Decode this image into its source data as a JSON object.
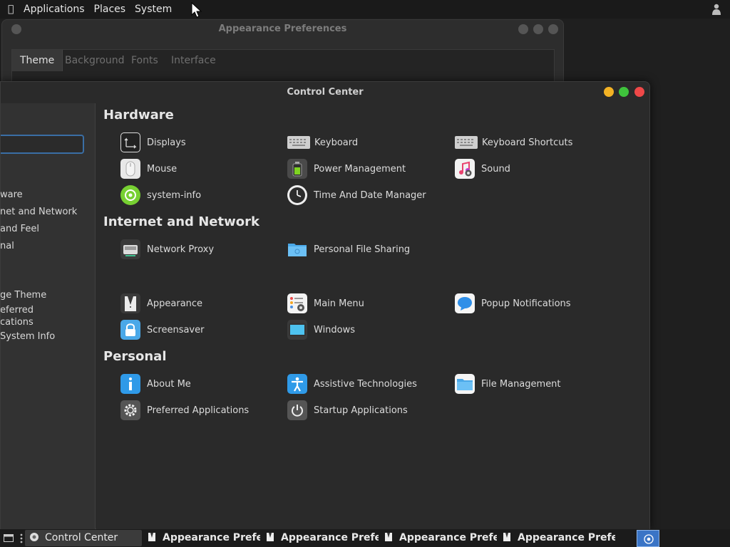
{
  "top_panel": {
    "menus": [
      "Applications",
      "Places",
      "System"
    ],
    "icons": {
      "logo": "apple-icon",
      "tray": "user-icon"
    }
  },
  "background_window": {
    "title": "Appearance Preferences",
    "tabs": [
      "Theme",
      "Background",
      "Fonts",
      "Interface"
    ],
    "active_tab": "Theme"
  },
  "control_center": {
    "title": "Control Center",
    "sidebar": {
      "categories": [
        "ware",
        "net and Network",
        "and Feel",
        "nal"
      ],
      "common_tasks": [
        "ge Theme",
        "eferred",
        "cations",
        "System Info"
      ]
    },
    "sections": [
      {
        "title": "Hardware",
        "items": [
          {
            "label": "Displays",
            "icon": "display-icon"
          },
          {
            "label": "Keyboard",
            "icon": "keyboard-icon"
          },
          {
            "label": "Keyboard Shortcuts",
            "icon": "keyboard-icon"
          },
          {
            "label": "Mouse",
            "icon": "mouse-icon"
          },
          {
            "label": "Power Management",
            "icon": "battery-icon"
          },
          {
            "label": "Sound",
            "icon": "music-note-icon"
          },
          {
            "label": "system-info",
            "icon": "system-info-icon"
          },
          {
            "label": "Time And Date Manager",
            "icon": "clock-icon"
          }
        ]
      },
      {
        "title": "Internet and Network",
        "items": [
          {
            "label": "Network Proxy",
            "icon": "network-proxy-icon"
          },
          {
            "label": "Personal File Sharing",
            "icon": "folder-icon"
          }
        ]
      },
      {
        "title": "",
        "items": [
          {
            "label": "Appearance",
            "icon": "tuxedo-icon"
          },
          {
            "label": "Main Menu",
            "icon": "menu-list-icon"
          },
          {
            "label": "Popup Notifications",
            "icon": "chat-bubble-icon"
          },
          {
            "label": "Screensaver",
            "icon": "lock-icon"
          },
          {
            "label": "Windows",
            "icon": "window-icon"
          }
        ]
      },
      {
        "title": "Personal",
        "items": [
          {
            "label": "About Me",
            "icon": "info-icon"
          },
          {
            "label": "Assistive Technologies",
            "icon": "accessibility-icon"
          },
          {
            "label": "File Management",
            "icon": "folder-icon"
          },
          {
            "label": "Preferred Applications",
            "icon": "gear-icon"
          },
          {
            "label": "Startup Applications",
            "icon": "power-icon"
          }
        ]
      }
    ]
  },
  "taskbar": {
    "tasks": [
      {
        "label": "Control Center",
        "active": true
      },
      {
        "label": "Appearance Prefere...",
        "active": false
      },
      {
        "label": "Appearance Prefere...",
        "active": false
      },
      {
        "label": "Appearance Prefere...",
        "active": false
      },
      {
        "label": "Appearance Prefere...",
        "active": false
      }
    ]
  },
  "colors": {
    "accent": "#3a74c6",
    "minimize": "#f3b224",
    "maximize": "#3fc33c",
    "close": "#ef4848"
  }
}
